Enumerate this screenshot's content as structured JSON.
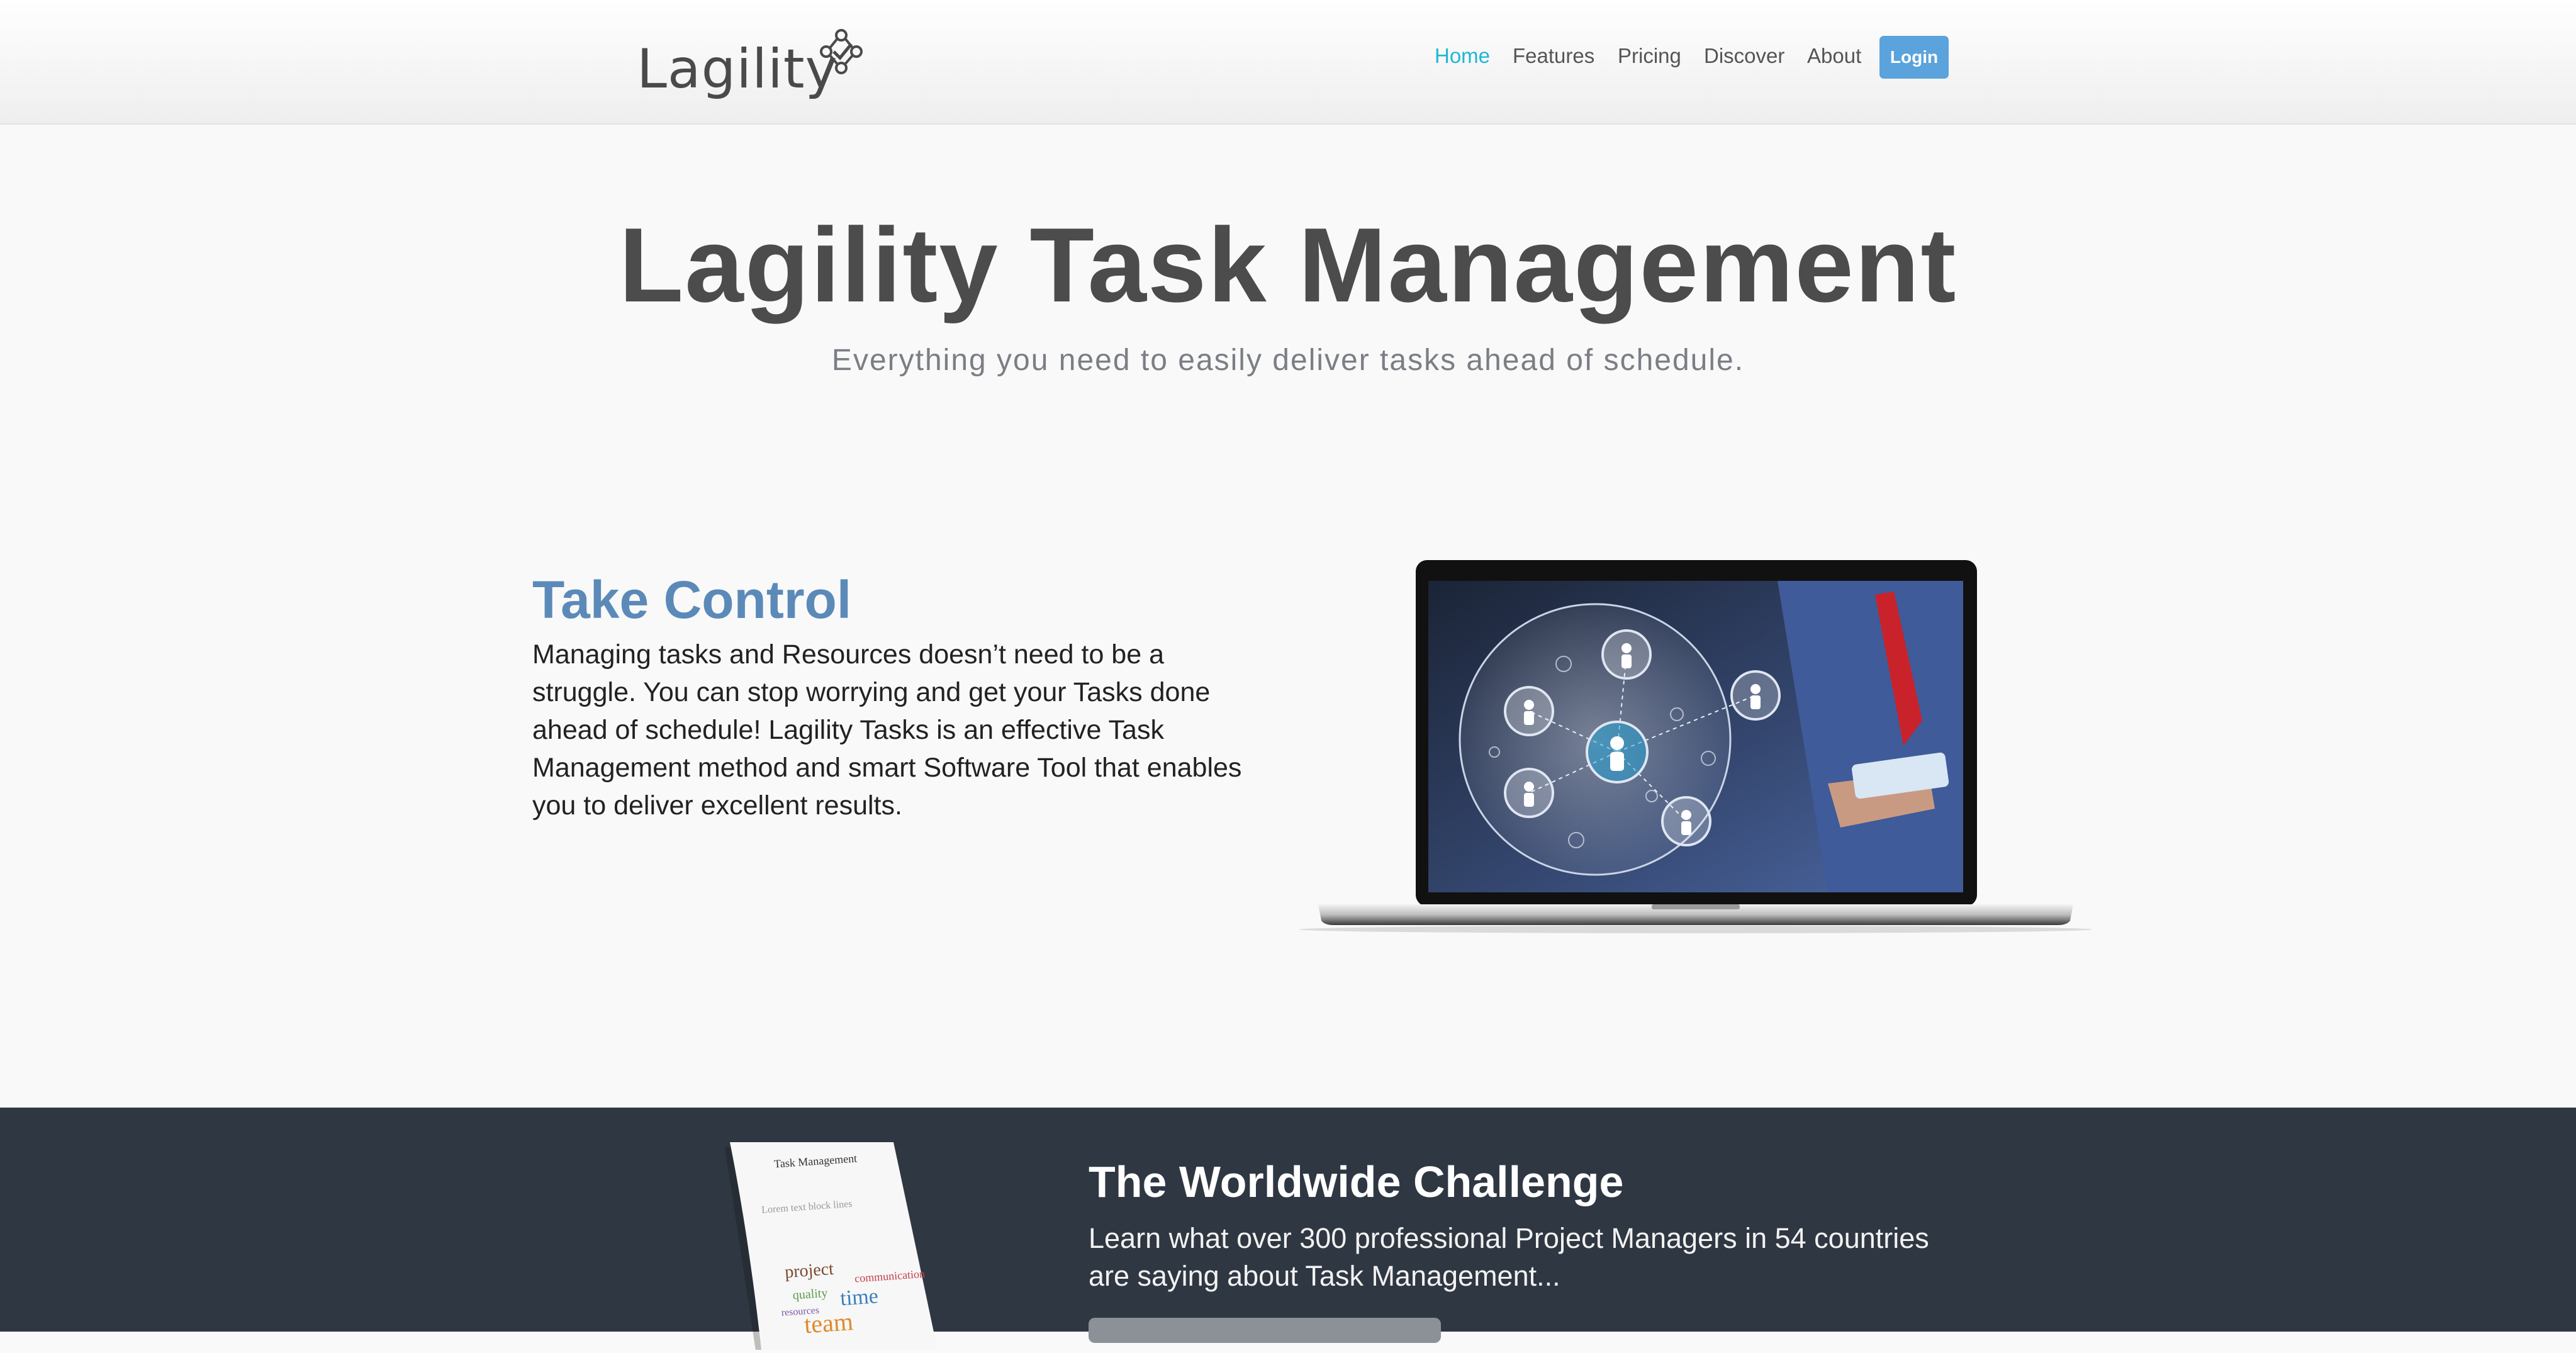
{
  "header": {
    "logo_text": "Lagility",
    "nav": [
      {
        "label": "Home",
        "active": true
      },
      {
        "label": "Features",
        "active": false
      },
      {
        "label": "Pricing",
        "active": false
      },
      {
        "label": "Discover",
        "active": false
      },
      {
        "label": "About",
        "active": false
      }
    ],
    "login_label": "Login"
  },
  "hero": {
    "title": "Lagility Task Management",
    "subtitle": "Everything you need to easily deliver tasks ahead of schedule."
  },
  "take_control": {
    "heading": "Take Control",
    "body": "Managing tasks and Resources doesn’t need to be a struggle.  You can stop worrying and get your Tasks done ahead of schedule!  Lagility Tasks is an effective Task Management method and smart Software Tool that enables you to deliver excellent results."
  },
  "challenge": {
    "doc_title": "Task Management",
    "title": "The Worldwide Challenge",
    "body": "Learn what over 300 professional Project Managers in 54 countries are saying about Task Management..."
  },
  "colors": {
    "accent": "#1fb6d6",
    "login_bg": "#5aa3dc",
    "heading_blue": "#5b8ab8",
    "band_bg": "#2f3742"
  }
}
